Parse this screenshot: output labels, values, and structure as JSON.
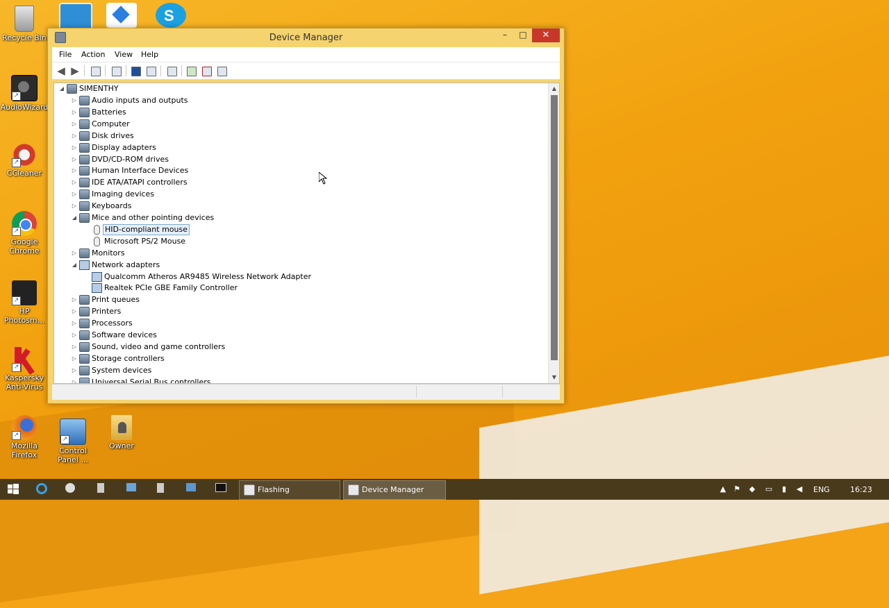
{
  "desktop": {
    "icons": [
      {
        "id": "recycle",
        "label": "Recycle Bin"
      },
      {
        "id": "audiowizard",
        "label": "AudioWizard"
      },
      {
        "id": "ccleaner",
        "label": "CCleaner"
      },
      {
        "id": "chrome",
        "label1": "Google",
        "label2": "Chrome"
      },
      {
        "id": "hp",
        "label1": "HP",
        "label2": "Photosm..."
      },
      {
        "id": "kaspersky",
        "label1": "Kaspersky",
        "label2": "Anti-Virus"
      },
      {
        "id": "firefox",
        "label1": "Mozilla",
        "label2": "Firefox"
      },
      {
        "id": "controlpanel",
        "label1": "Control",
        "label2": "Panel ..."
      },
      {
        "id": "owner",
        "label": "Owner"
      }
    ]
  },
  "window": {
    "title": "Device Manager",
    "controls": {
      "minimize": "–",
      "maximize": "□",
      "close": "✕"
    },
    "menu": [
      "File",
      "Action",
      "View",
      "Help"
    ],
    "tree": {
      "root": "SIMENTHY",
      "items": [
        {
          "label": "Audio inputs and outputs",
          "expanded": false
        },
        {
          "label": "Batteries",
          "expanded": false
        },
        {
          "label": "Computer",
          "expanded": false
        },
        {
          "label": "Disk drives",
          "expanded": false
        },
        {
          "label": "Display adapters",
          "expanded": false
        },
        {
          "label": "DVD/CD-ROM drives",
          "expanded": false
        },
        {
          "label": "Human Interface Devices",
          "expanded": false
        },
        {
          "label": "IDE ATA/ATAPI controllers",
          "expanded": false
        },
        {
          "label": "Imaging devices",
          "expanded": false
        },
        {
          "label": "Keyboards",
          "expanded": false
        },
        {
          "label": "Mice and other pointing devices",
          "expanded": true
        },
        {
          "label": "HID-compliant mouse",
          "child": true,
          "selected": true
        },
        {
          "label": "Microsoft PS/2 Mouse",
          "child": true
        },
        {
          "label": "Monitors",
          "expanded": false
        },
        {
          "label": "Network adapters",
          "expanded": true
        },
        {
          "label": "Qualcomm Atheros AR9485 Wireless Network Adapter",
          "child": true
        },
        {
          "label": "Realtek PCIe GBE Family Controller",
          "child": true
        },
        {
          "label": "Print queues",
          "expanded": false
        },
        {
          "label": "Printers",
          "expanded": false
        },
        {
          "label": "Processors",
          "expanded": false
        },
        {
          "label": "Software devices",
          "expanded": false
        },
        {
          "label": "Sound, video and game controllers",
          "expanded": false
        },
        {
          "label": "Storage controllers",
          "expanded": false
        },
        {
          "label": "System devices",
          "expanded": false
        },
        {
          "label": "Universal Serial Bus controllers",
          "expanded": false
        }
      ]
    }
  },
  "taskbar": {
    "buttons": [
      {
        "label": "Flashing"
      },
      {
        "label": "Device Manager"
      }
    ],
    "tray": {
      "language": "ENG",
      "time": "16:23"
    }
  },
  "colors": {
    "accent": "#f5d36e",
    "close": "#c7382b",
    "taskbar": "#4a3a1c"
  }
}
